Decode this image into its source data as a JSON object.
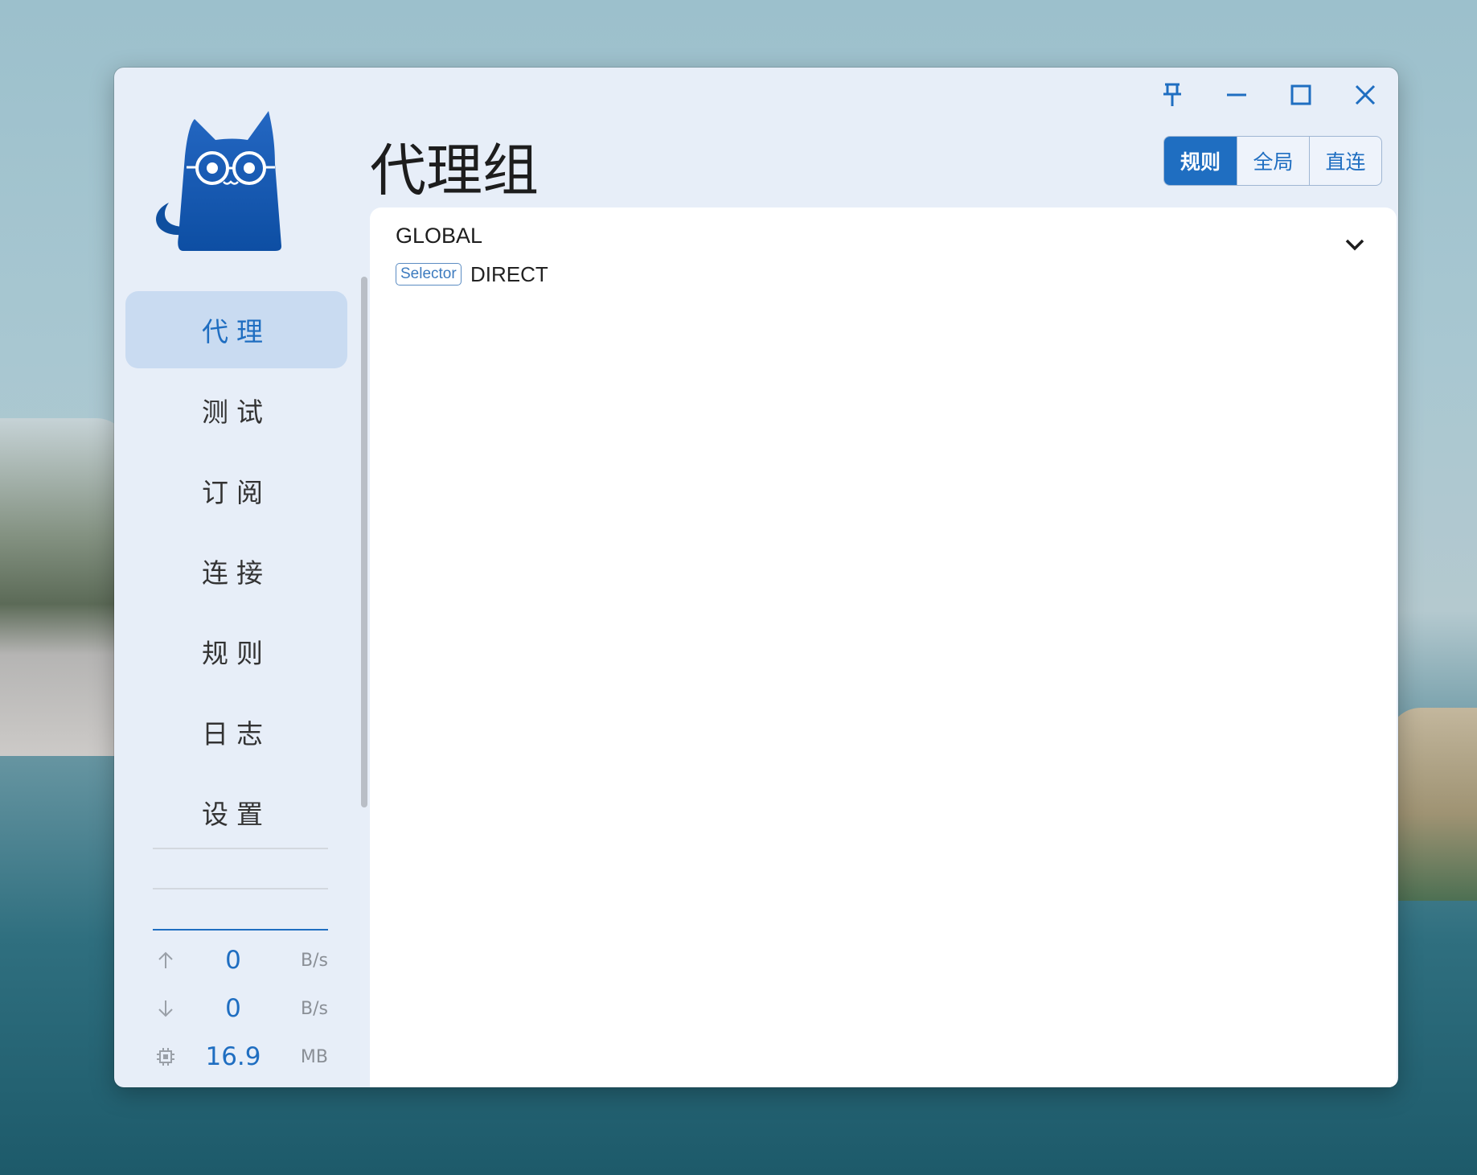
{
  "window_controls": [
    "pin-icon",
    "minimize-icon",
    "maximize-icon",
    "close-icon"
  ],
  "sidebar": {
    "logo": "cat-logo",
    "items": [
      {
        "label": "代理",
        "active": true
      },
      {
        "label": "测试",
        "active": false
      },
      {
        "label": "订阅",
        "active": false
      },
      {
        "label": "连接",
        "active": false
      },
      {
        "label": "规则",
        "active": false
      },
      {
        "label": "日志",
        "active": false
      },
      {
        "label": "设置",
        "active": false
      }
    ],
    "traffic": {
      "upload": {
        "icon": "arrow-up-icon",
        "value": "0",
        "unit": "B/s"
      },
      "download": {
        "icon": "arrow-down-icon",
        "value": "0",
        "unit": "B/s"
      },
      "memory": {
        "icon": "cpu-chip-icon",
        "value": "16.9",
        "unit": "MB"
      }
    }
  },
  "header": {
    "title": "代理组",
    "modes": [
      {
        "label": "规则",
        "active": true
      },
      {
        "label": "全局",
        "active": false
      },
      {
        "label": "直连",
        "active": false
      }
    ]
  },
  "groups": [
    {
      "name": "GLOBAL",
      "type": "Selector",
      "now": "DIRECT"
    }
  ],
  "colors": {
    "accent": "#1f6ec1",
    "window_bg": "#e7eef8",
    "active_nav_bg": "#c9dbf1"
  }
}
